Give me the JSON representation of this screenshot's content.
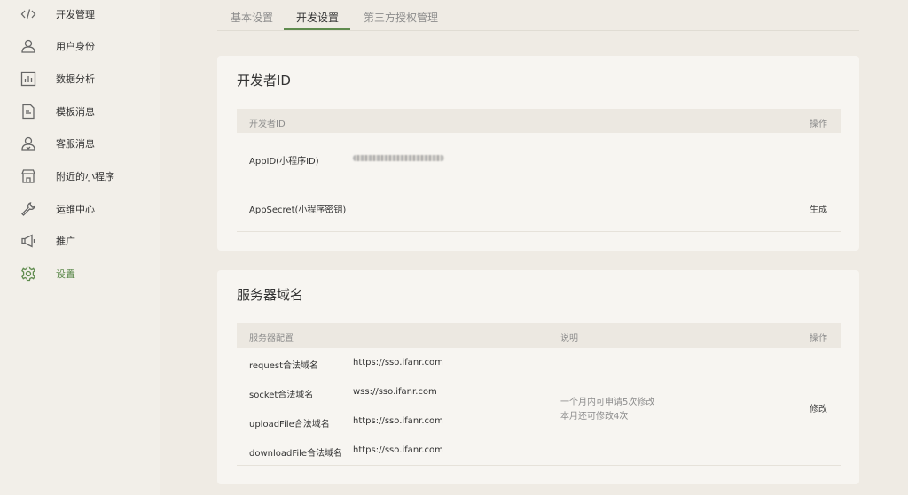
{
  "sidebar": {
    "items": [
      {
        "label": "开发管理",
        "icon": "code-icon"
      },
      {
        "label": "用户身份",
        "icon": "user-icon"
      },
      {
        "label": "数据分析",
        "icon": "chart-icon"
      },
      {
        "label": "模板消息",
        "icon": "document-icon"
      },
      {
        "label": "客服消息",
        "icon": "support-user-icon"
      },
      {
        "label": "附近的小程序",
        "icon": "store-icon"
      },
      {
        "label": "运维中心",
        "icon": "wrench-icon"
      },
      {
        "label": "推广",
        "icon": "megaphone-icon"
      },
      {
        "label": "设置",
        "icon": "gear-icon",
        "active": true
      }
    ]
  },
  "tabs": [
    {
      "label": "基本设置"
    },
    {
      "label": "开发设置",
      "active": true
    },
    {
      "label": "第三方授权管理"
    }
  ],
  "developer_card": {
    "title": "开发者ID",
    "header_name": "开发者ID",
    "header_action": "操作",
    "rows": [
      {
        "name": "AppID(小程序ID)",
        "value_blurred": true,
        "action": ""
      },
      {
        "name": "AppSecret(小程序密钥)",
        "action": "生成"
      }
    ]
  },
  "server_card": {
    "title": "服务器域名",
    "header_config": "服务器配置",
    "header_desc": "说明",
    "header_action": "操作",
    "rows": [
      {
        "name": "request合法域名",
        "value": "https://sso.ifanr.com"
      },
      {
        "name": "socket合法域名",
        "value": "wss://sso.ifanr.com"
      },
      {
        "name": "uploadFile合法域名",
        "value": "https://sso.ifanr.com"
      },
      {
        "name": "downloadFile合法域名",
        "value": "https://sso.ifanr.com"
      }
    ],
    "desc_line1": "一个月内可申请5次修改",
    "desc_line2": "本月还可修改4次",
    "action": "修改"
  },
  "colors": {
    "accent": "#5f8b4e",
    "background": "#efebe4",
    "card": "#f7f5f1"
  }
}
